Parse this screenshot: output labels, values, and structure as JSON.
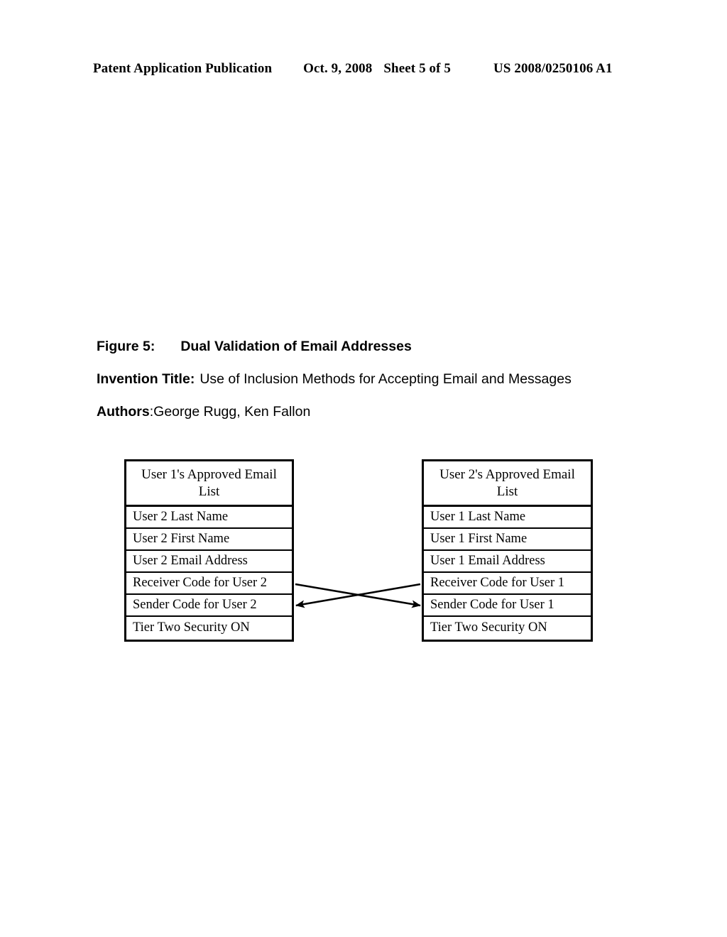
{
  "header": {
    "publication": "Patent Application Publication",
    "date": "Oct. 9, 2008",
    "sheet": "Sheet 5 of 5",
    "patent_number": "US 2008/0250106 A1"
  },
  "caption": {
    "figure_label": "Figure 5:",
    "figure_title": "Dual Validation of Email Addresses",
    "invention_label": "Invention Title:",
    "invention_title": "Use of Inclusion Methods for Accepting Email and Messages",
    "authors_label": "Authors",
    "authors_separator": ":",
    "authors_names": "George Rugg, Ken Fallon"
  },
  "diagram": {
    "tables": [
      {
        "id": "user1-approved-email-list",
        "header": "User 1's Approved Email List",
        "rows": [
          "User 2 Last Name",
          "User 2 First Name",
          "User 2 Email Address",
          "Receiver Code for User 2",
          "Sender Code for User 2",
          "Tier Two Security ON"
        ]
      },
      {
        "id": "user2-approved-email-list",
        "header": "User 2's Approved Email List",
        "rows": [
          "User 1 Last Name",
          "User 1 First Name",
          "User 1 Email Address",
          "Receiver Code for User 1",
          "Sender Code for User 1",
          "Tier Two Security ON"
        ]
      }
    ],
    "connectors": [
      {
        "id": "receiver-left-to-sender-right",
        "from": "User 1 Receiver Code row",
        "to": "User 2 Sender Code row",
        "direction": "right"
      },
      {
        "id": "receiver-right-to-sender-left",
        "from": "User 2 Receiver Code row",
        "to": "User 1 Sender Code row",
        "direction": "left"
      }
    ]
  },
  "colors": {
    "ink": "#000000",
    "page": "#ffffff"
  }
}
